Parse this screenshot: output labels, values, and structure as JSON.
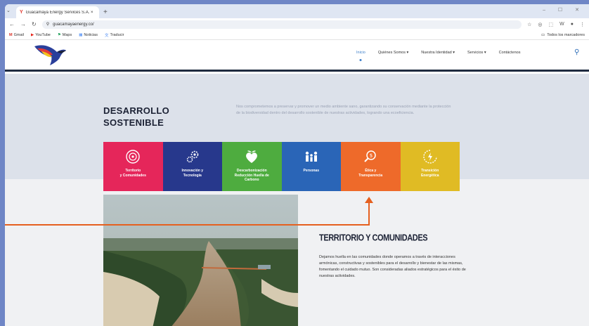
{
  "browser": {
    "tab_title": "Guacamaya Energy Services S.A. ×",
    "tab_favicon": "Y",
    "new_tab": "+",
    "url": "guacamayaenergy.co/",
    "window_controls": "–  ☐  ✕",
    "bookmarks": [
      {
        "label": "Gmail",
        "icon": "gmail-icon"
      },
      {
        "label": "YouTube",
        "icon": "youtube-icon"
      },
      {
        "label": "Maps",
        "icon": "maps-icon"
      },
      {
        "label": "Noticias",
        "icon": "news-icon"
      },
      {
        "label": "Traducir",
        "icon": "translate-icon"
      }
    ],
    "all_bookmarks": "Todos los marcadores"
  },
  "nav": {
    "items": [
      {
        "label": "Inicio",
        "active": true
      },
      {
        "label": "Quiénes Somos ▾",
        "active": false
      },
      {
        "label": "Nuestra Identidad ▾",
        "active": false
      },
      {
        "label": "Servicios ▾",
        "active": false
      },
      {
        "label": "Contáctenos",
        "active": false
      }
    ]
  },
  "hero": {
    "title_line1": "DESARROLLO",
    "title_line2": "SOSTENIBLE",
    "text": "Nos comprometemos a preservar y promover un medio ambiente sano, garantizando su conservación mediante la protección de la biodiversidad dentro del desarrollo sostenible de nuestras actividades, logrando una ecoeficiencia."
  },
  "cards": [
    {
      "line1": "Territorio",
      "line2": "y Comunidades",
      "line3": "",
      "color": "#e5265a",
      "icon": "target-icon"
    },
    {
      "line1": "Innovación y",
      "line2": "Tecnología",
      "line3": "",
      "color": "#27388c",
      "icon": "gears-icon"
    },
    {
      "line1": "Descarbonización",
      "line2": "Reducción Huella de",
      "line3": "Carbono",
      "color": "#4eac3f",
      "icon": "plant-heart-icon"
    },
    {
      "line1": "Personas",
      "line2": "",
      "line3": "",
      "color": "#2a65b7",
      "icon": "people-icon"
    },
    {
      "line1": "Ética y",
      "line2": "Transparencia",
      "line3": "",
      "color": "#ee6a2a",
      "icon": "magnifier-icon"
    },
    {
      "line1": "Transición",
      "line2": "Energética",
      "line3": "",
      "color": "#e0bb24",
      "icon": "energy-icon"
    }
  ],
  "section": {
    "title": "TERRITORIO Y COMUNIDADES",
    "text": "Dejamos huella en las comunidades donde operamos a través de interacciones armónicas, constructivas y sostenibles para el desarrollo y bienestar de las mismas, fomentando el cuidado mutuo. Son consideradas aliados estratégicos para el éxito de nuestras actividades."
  },
  "colors": {
    "accent": "#3d7fc9",
    "annotation": "#e5601f",
    "navy": "#1c2235"
  }
}
